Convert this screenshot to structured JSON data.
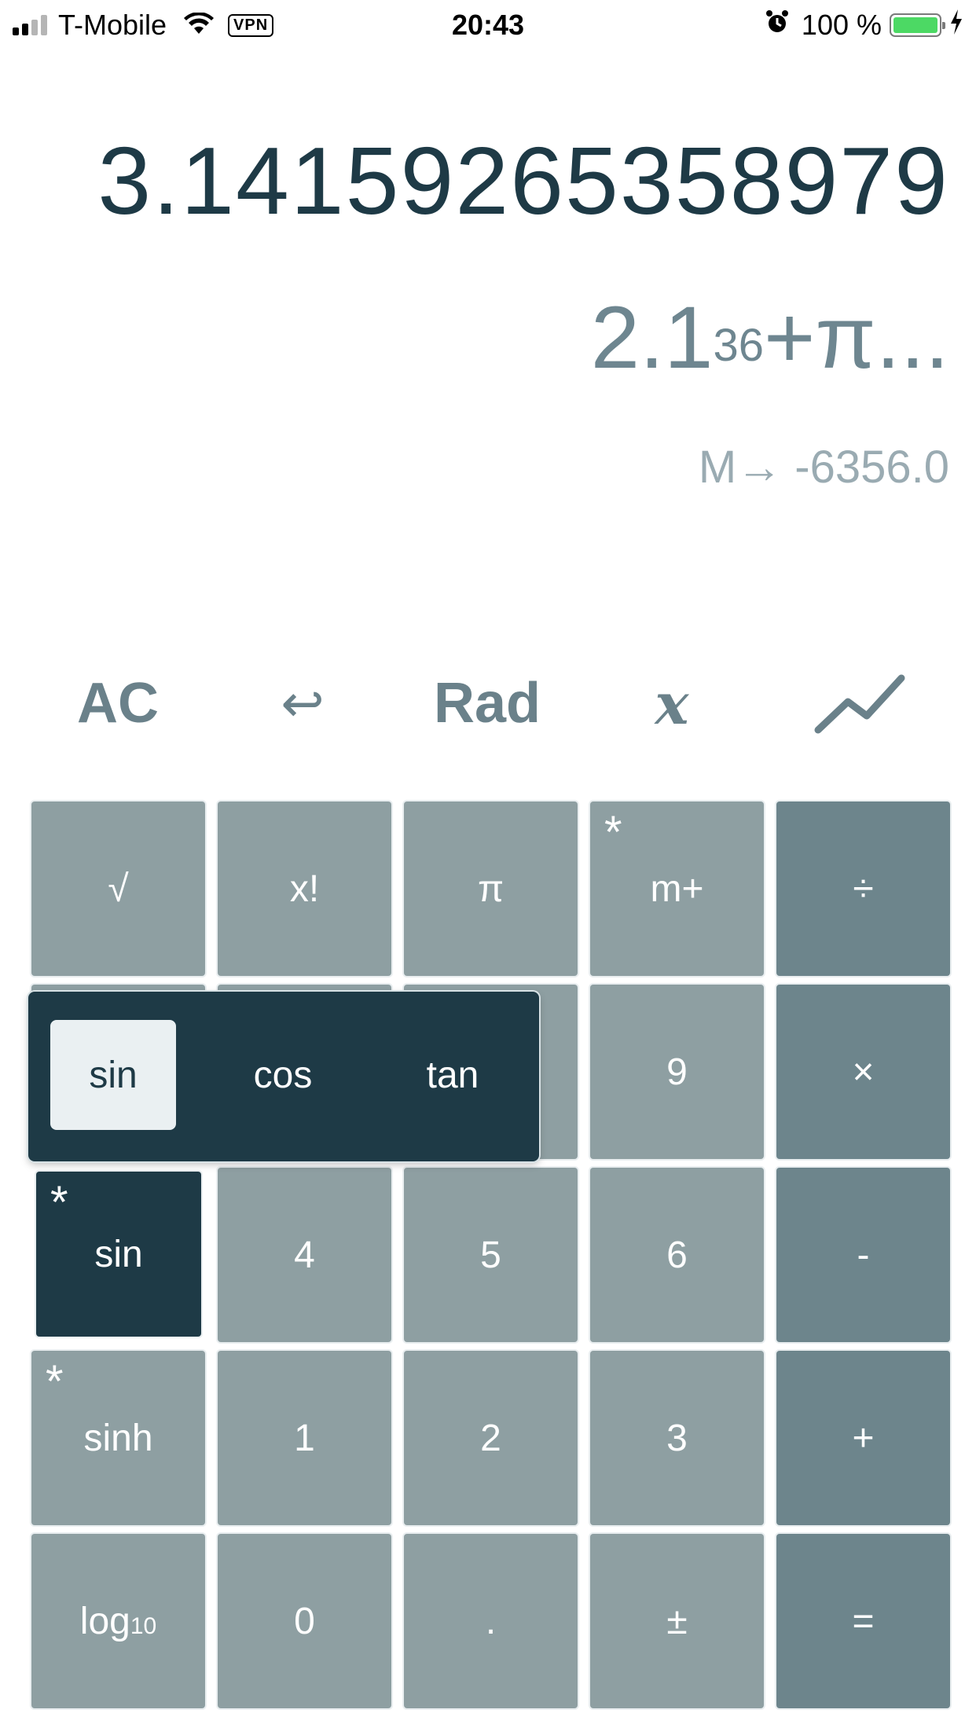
{
  "status_bar": {
    "carrier": "T-Mobile",
    "vpn": "VPN",
    "time": "20:43",
    "battery_percent": "100 %",
    "icons": [
      "signal-icon",
      "wifi-icon",
      "alarm-icon",
      "battery-icon",
      "charging-icon"
    ]
  },
  "display": {
    "result": "3.14159265358979",
    "expression_base": "2.1",
    "expression_exponent": "36",
    "expression_rest": "+π...",
    "memory": "M→ -6356.0"
  },
  "toolbar": {
    "clear": "AC",
    "undo": "↩",
    "angle_mode": "Rad",
    "variable": "x",
    "graph_icon": "graph-line-icon"
  },
  "keypad": {
    "sqrt": "√",
    "factorial": "x!",
    "pi": "π",
    "memory_add": "m+",
    "divide": "÷",
    "nine": "9",
    "multiply": "×",
    "trig_sin": "sin",
    "four": "4",
    "five": "5",
    "six": "6",
    "minus": "-",
    "hyperbolic_sinh": "sinh",
    "one": "1",
    "two": "2",
    "three": "3",
    "plus": "+",
    "log_base": "log",
    "log_sub": "10",
    "zero": "0",
    "decimal": ".",
    "plus_minus": "±",
    "equals": "=",
    "star_marker": "*"
  },
  "trig_popup": {
    "options": [
      "sin",
      "cos",
      "tan"
    ],
    "selected": "sin"
  },
  "colors": {
    "dark_accent": "#1e3a46",
    "key_gray": "#8e9fa2",
    "operator_gray": "#6d858c",
    "battery_green": "#4cd964"
  }
}
